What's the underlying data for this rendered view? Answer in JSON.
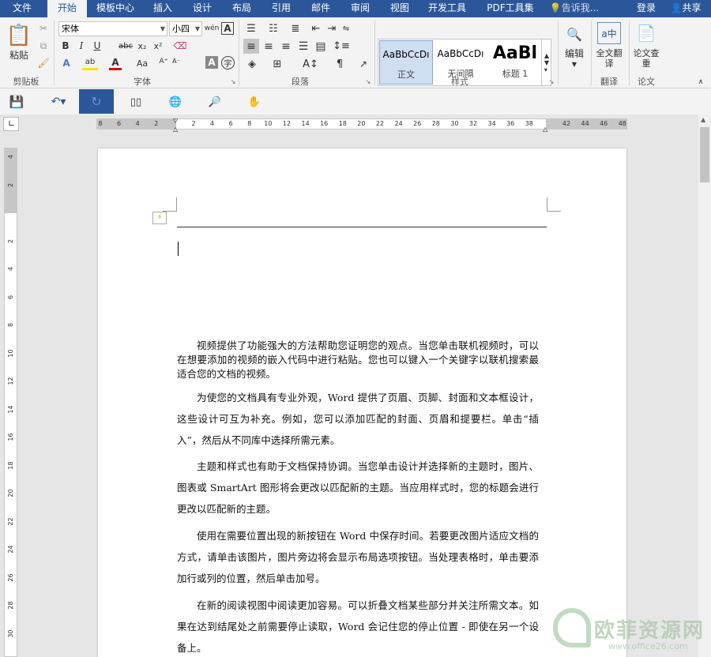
{
  "menubar": {
    "tabs": [
      "文件",
      "开始",
      "模板中心",
      "插入",
      "设计",
      "布局",
      "引用",
      "邮件",
      "审阅",
      "视图",
      "开发工具",
      "PDF工具集"
    ],
    "active_tab": "开始",
    "tell_me_placeholder": "告诉我...",
    "login": "登录",
    "share": "共享",
    "colors": {
      "bar": "#2b579a",
      "active_tab_text": "#2b579a"
    }
  },
  "ribbon": {
    "clipboard": {
      "paste": "粘贴",
      "label": "剪贴板"
    },
    "font": {
      "name": "宋体",
      "size": "小四",
      "wen": "wén",
      "label": "字体",
      "buttons": {
        "bold": "B",
        "italic": "I",
        "underline": "U",
        "strike": "abc",
        "subscript": "x₂",
        "superscript": "x²",
        "text_effect": "A",
        "highlight": "ab",
        "font_color": "A",
        "change_case": "Aa",
        "char_shading": "A",
        "enclose": "字"
      }
    },
    "paragraph": {
      "label": "段落"
    },
    "styles": {
      "items": [
        {
          "preview": "AaBbCcDı",
          "name": "正文"
        },
        {
          "preview": "AaBbCcDı",
          "name": "无间隔"
        },
        {
          "preview": "AaBl",
          "name": "标题 1"
        }
      ],
      "label": "样式"
    },
    "editing": {
      "label": "编辑"
    },
    "translate": {
      "full": "全文翻译",
      "label": "翻译"
    },
    "paper": {
      "check": "论文查重",
      "label": "论文"
    }
  },
  "ruler": {
    "h_ticks": [
      "8",
      "6",
      "4",
      "2",
      "",
      "2",
      "4",
      "6",
      "8",
      "10",
      "12",
      "14",
      "16",
      "18",
      "20",
      "22",
      "24",
      "26",
      "28",
      "30",
      "32",
      "34",
      "36",
      "38",
      "",
      "42",
      "44",
      "46",
      "48"
    ],
    "v_ticks": [
      "4",
      "2",
      "",
      "2",
      "4",
      "6",
      "8",
      "10",
      "12",
      "14",
      "16",
      "18",
      "20",
      "22",
      "24",
      "26",
      "28",
      "30"
    ]
  },
  "document": {
    "paragraphs": [
      "视频提供了功能强大的方法帮助您证明您的观点。当您单击联机视频时，可以在想要添加的视频的嵌入代码中进行粘贴。您也可以键入一个关键字以联机搜索最适合您的文档的视频。",
      "为使您的文档具有专业外观，Word 提供了页眉、页脚、封面和文本框设计，这些设计可互为补充。例如，您可以添加匹配的封面、页眉和提要栏。单击“插入”，然后从不同库中选择所需元素。",
      "主题和样式也有助于文档保持协调。当您单击设计并选择新的主题时，图片、图表或 SmartArt 图形将会更改以匹配新的主题。当应用样式时，您的标题会进行更改以匹配新的主题。",
      "使用在需要位置出现的新按钮在 Word 中保存时间。若要更改图片适应文档的方式，请单击该图片，图片旁边将会显示布局选项按钮。当处理表格时，单击要添加行或列的位置，然后单击加号。",
      "在新的阅读视图中阅读更加容易。可以折叠文档某些部分并关注所需文本。如果在达到结尾处之前需要停止读取，Word 会记住您的停止位置 - 即使在另一个设备上。"
    ]
  },
  "watermark": {
    "brand": "欧菲资源网",
    "url": "www.office26.com"
  }
}
